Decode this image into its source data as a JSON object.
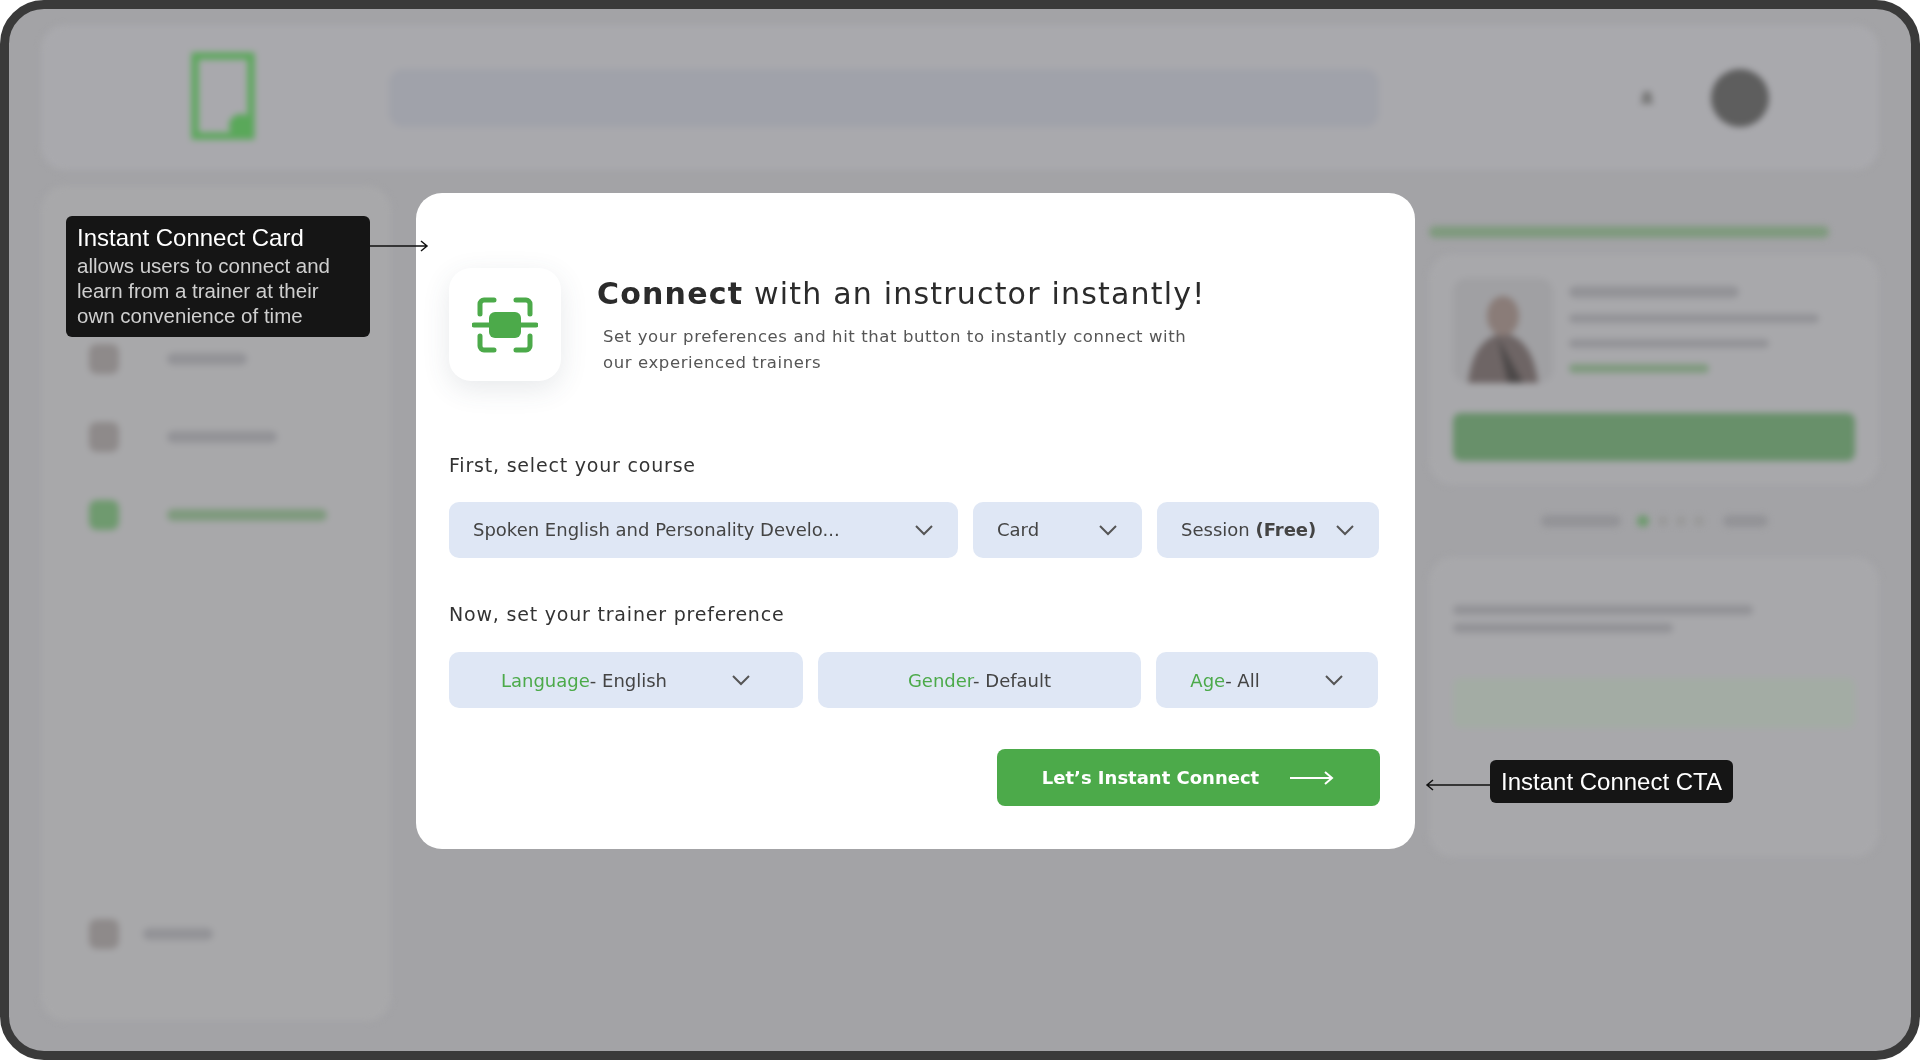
{
  "annotations": [
    {
      "title": "Instant Connect Card",
      "body": "allows users to connect and learn from a trainer at their own convenience of time"
    },
    {
      "title": "Instant Connect CTA"
    }
  ],
  "modal": {
    "title": "**Connect** with an instructor instantly!",
    "subtitle": "Set your preferences and hit that button to instantly connect with our experienced trainers",
    "course_label": "First, select your course",
    "course_selects": [
      {
        "value": "Spoken English and Personality Develo..."
      },
      {
        "value": "Card"
      },
      {
        "value": "Session **(Free)**"
      }
    ],
    "trainer_label": "Now, set your trainer preference",
    "trainer_selects": [
      {
        "label": "Language",
        "value": "- English",
        "caret": true
      },
      {
        "label": "Gender",
        "value": "- Default",
        "caret": false
      },
      {
        "label": "Age",
        "value": "- All",
        "caret": true
      }
    ],
    "button": "Let’s Instant Connect"
  }
}
